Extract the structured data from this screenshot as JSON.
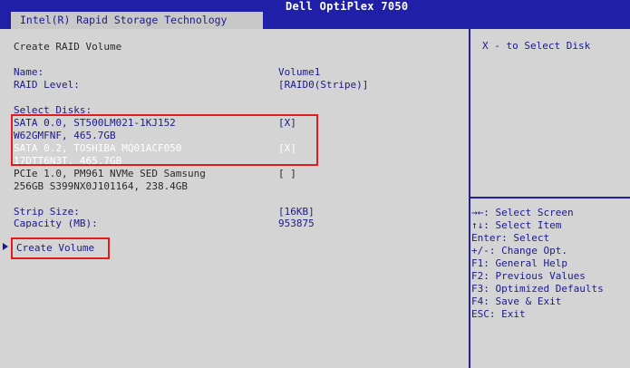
{
  "header": {
    "tab_label": "Intel(R) Rapid Storage Technology",
    "machine_name": "Dell OptiPlex 7050"
  },
  "main": {
    "page_title": "Create RAID Volume",
    "name_label": "Name:",
    "name_value": "Volume1",
    "raid_level_label": "RAID Level:",
    "raid_level_value": "[RAID0(Stripe)]",
    "select_disks_label": "Select Disks:",
    "disks": [
      {
        "line1": "SATA 0.0, ST500LM021-1KJ152",
        "line2": "W62GMFNF, 465.7GB",
        "selected": "[X]"
      },
      {
        "line1": "SATA 0.2, TOSHIBA MQ01ACF050",
        "line2": "17DTT6N3T, 465.7GB",
        "selected": "[X]"
      },
      {
        "line1": "PCIe 1.0, PM961 NVMe SED Samsung",
        "line2": "256GB S399NX0J101164, 238.4GB",
        "selected": "[ ]"
      }
    ],
    "strip_size_label": "Strip Size:",
    "strip_size_value": "[16KB]",
    "capacity_label": "Capacity (MB):",
    "capacity_value": "953875",
    "create_volume_label": "Create Volume"
  },
  "help": {
    "text": "X - to Select Disk"
  },
  "keys": [
    {
      "key": "→←:",
      "desc": "Select Screen"
    },
    {
      "key": "↑↓:",
      "desc": "Select Item"
    },
    {
      "key": "Enter:",
      "desc": "Select"
    },
    {
      "key": "+/-:",
      "desc": "Change Opt."
    },
    {
      "key": "F1:",
      "desc": "General Help"
    },
    {
      "key": "F2:",
      "desc": "Previous Values"
    },
    {
      "key": "F3:",
      "desc": "Optimized Defaults"
    },
    {
      "key": "F4:",
      "desc": "Save & Exit"
    },
    {
      "key": "ESC:",
      "desc": "Exit"
    }
  ],
  "colors": {
    "background": "#d4d4d4",
    "header_bar": "#1f1fa8",
    "text_blue": "#1a1a8c",
    "highlight_white": "#ffffff",
    "annotation_red": "#e21b1b"
  }
}
